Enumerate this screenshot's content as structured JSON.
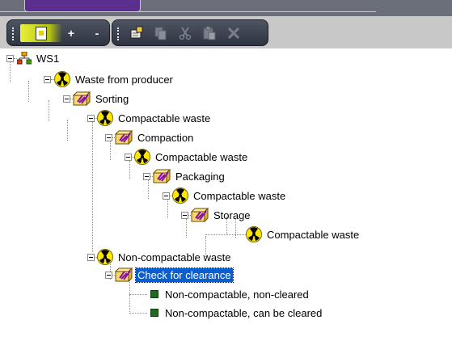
{
  "toolbar": {
    "add_symbol": "+",
    "remove_symbol": "-"
  },
  "tree": {
    "nodes": [
      {
        "label": "WS1",
        "icon": "workspace-icon"
      },
      {
        "label": "Waste from producer",
        "icon": "radiation-icon"
      },
      {
        "label": "Sorting",
        "icon": "process-box-icon"
      },
      {
        "label": "Compactable waste",
        "icon": "radiation-icon"
      },
      {
        "label": "Compaction",
        "icon": "process-box-icon"
      },
      {
        "label": "Compactable waste",
        "icon": "radiation-icon"
      },
      {
        "label": "Packaging",
        "icon": "process-box-icon"
      },
      {
        "label": "Compactable waste",
        "icon": "radiation-icon"
      },
      {
        "label": "Storage",
        "icon": "process-box-icon"
      },
      {
        "label": "Compactable waste",
        "icon": "radiation-icon"
      },
      {
        "label": "Non-compactable waste",
        "icon": "radiation-icon"
      },
      {
        "label": "Check for clearance",
        "icon": "process-box-icon",
        "selected": true
      },
      {
        "label": "Non-compactable, non-cleared",
        "icon": "green-square-icon"
      },
      {
        "label": "Non-compactable, can be cleared",
        "icon": "green-square-icon"
      }
    ]
  },
  "colors": {
    "toolbar_bg": "#c8c8c8",
    "toolbar_group": "#2f3440",
    "selection": "#0a5fd0",
    "radiation_yellow": "#ffe600"
  }
}
